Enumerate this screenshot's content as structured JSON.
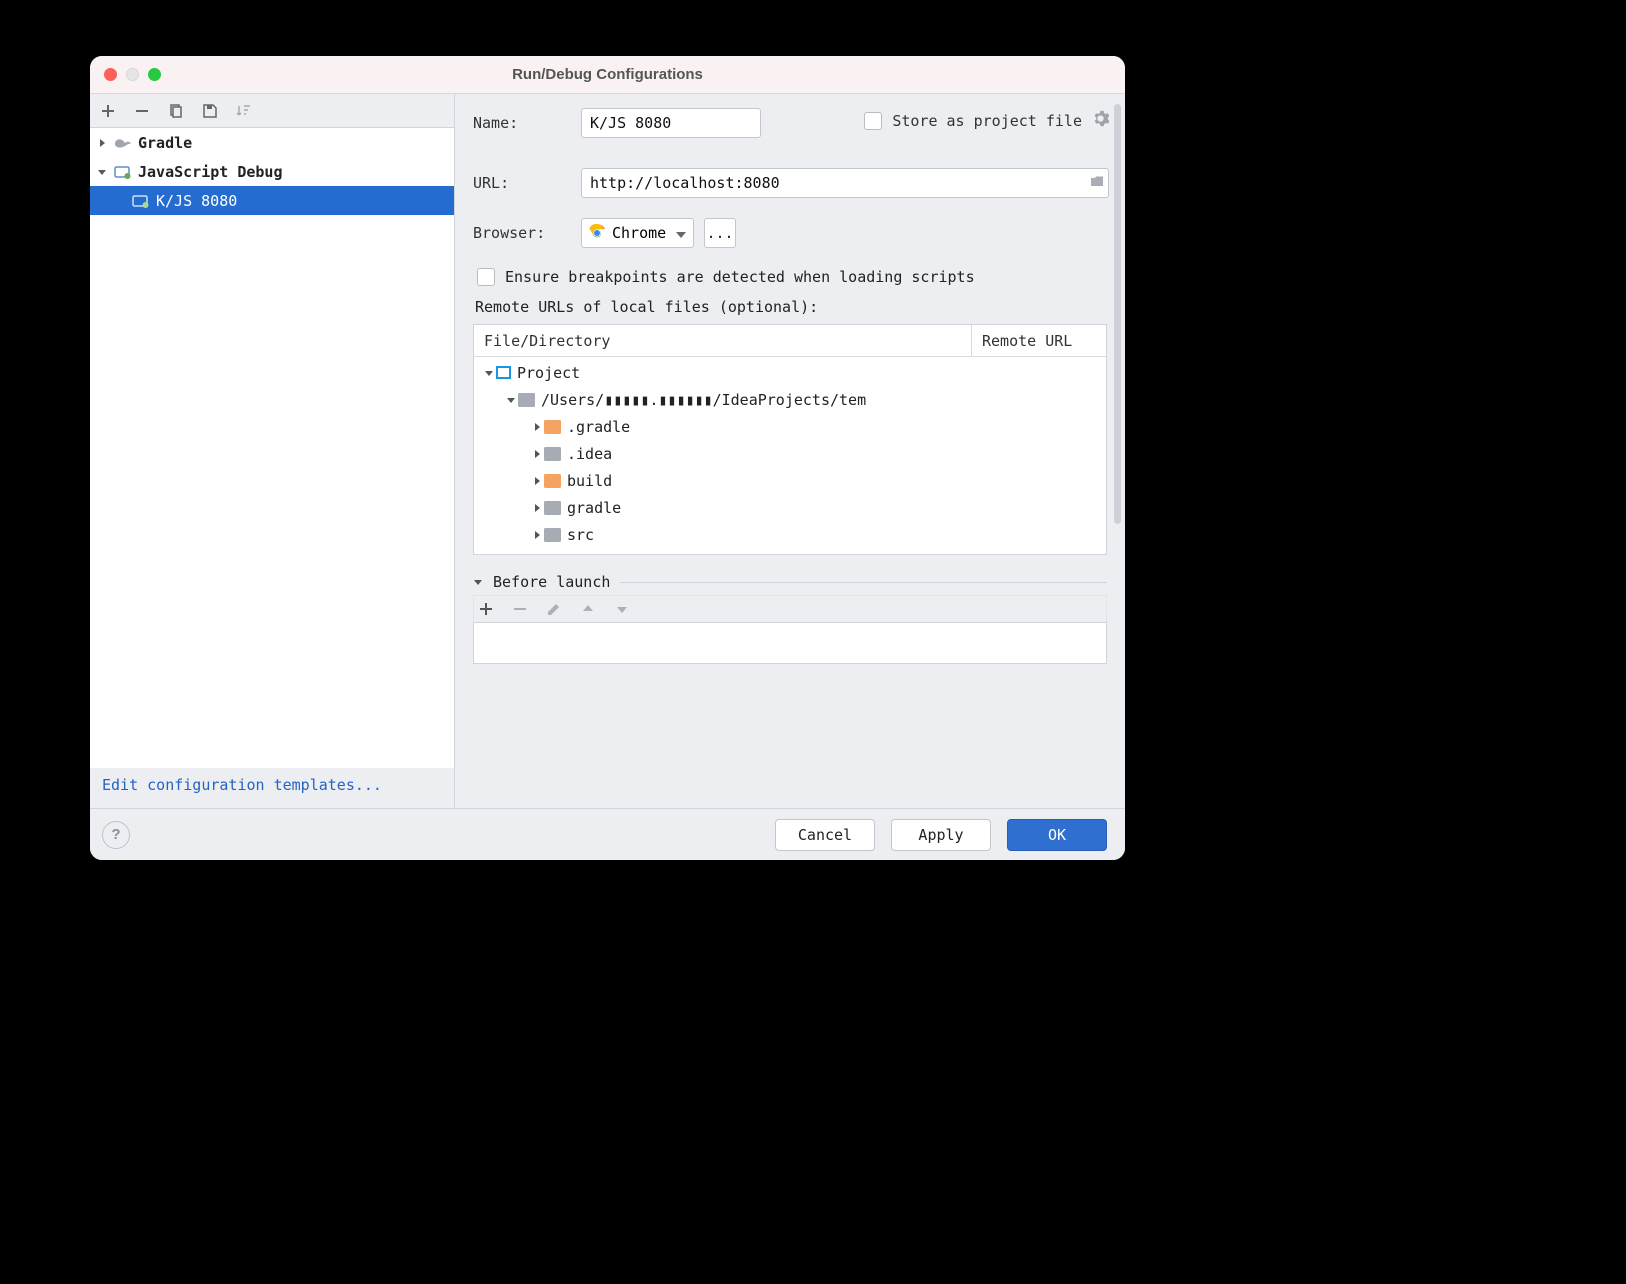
{
  "window_title": "Run/Debug Configurations",
  "left_toolbar": {},
  "config_tree": {
    "items": [
      {
        "kind": "group",
        "label": "Gradle",
        "expanded": false
      },
      {
        "kind": "group",
        "label": "JavaScript Debug",
        "expanded": true,
        "children": [
          {
            "label": "K/JS 8080",
            "selected": true
          }
        ]
      }
    ]
  },
  "edit_templates_link": "Edit configuration templates...",
  "form": {
    "name_label": "Name:",
    "name_value": "K/JS 8080",
    "store_label": "Store as project file",
    "url_label": "URL:",
    "url_value": "http://localhost:8080",
    "browser_label": "Browser:",
    "browser_value": "Chrome",
    "more_label": "...",
    "ensure_bp": "Ensure breakpoints are detected when loading scripts",
    "remote_title": "Remote URLs of local files (optional):",
    "table_head": {
      "c1": "File/Directory",
      "c2": "Remote URL"
    },
    "fs": {
      "project": "Project",
      "user_path": "/Users/▮▮▮▮▮.▮▮▮▮▮▮/IdeaProjects/tem",
      "children": [
        {
          "label": ".gradle",
          "color": "orange"
        },
        {
          "label": ".idea",
          "color": "grey"
        },
        {
          "label": "build",
          "color": "orange"
        },
        {
          "label": "gradle",
          "color": "grey"
        },
        {
          "label": "src",
          "color": "grey"
        }
      ]
    },
    "before_launch_title": "Before launch"
  },
  "buttons": {
    "cancel": "Cancel",
    "apply": "Apply",
    "ok": "OK"
  }
}
